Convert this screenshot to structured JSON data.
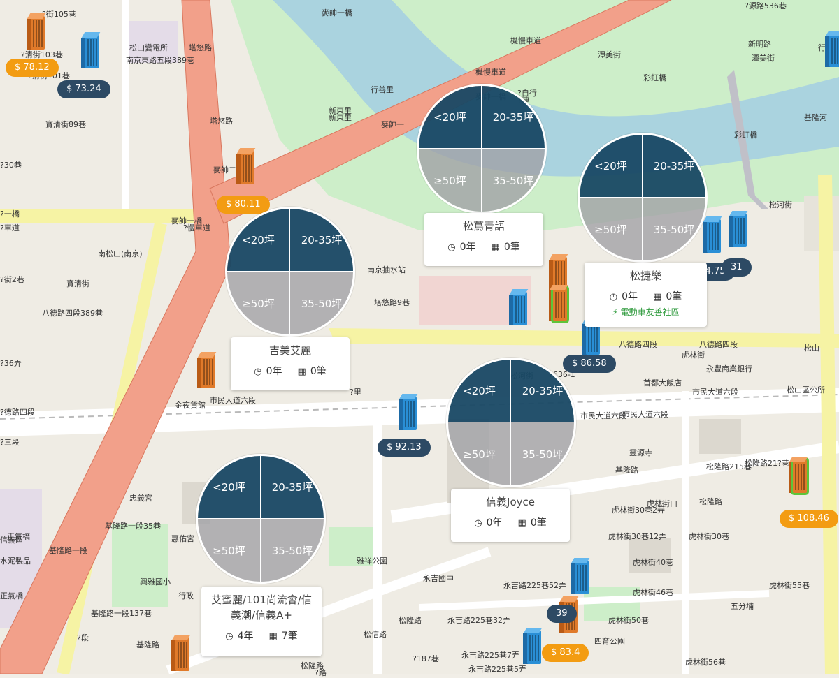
{
  "colors": {
    "river": "#aad3df",
    "park": "#c8f0c8",
    "major_road": "#f2a08a",
    "secondary_road": "#f6f3a4",
    "cluster_dark": "#184864",
    "cluster_light": "#a0a0a5",
    "price_orange": "#f39c12",
    "price_navy": "#2d4a64",
    "eco_green": "#2e9a3c"
  },
  "map_labels": [
    "?街105巷",
    "?清街103巷",
    "?清街101巷",
    "松山變電所",
    "南京東路五段389巷",
    "寶清街89巷",
    "?30巷",
    "麥帥一橋",
    "?車道",
    "?一橋",
    "?慢車道",
    "南松山(南京)",
    "寶清街",
    "?街2巷",
    "八德路四段389巷",
    "?36弄",
    "?德路四段",
    "?三段",
    "塔悠路",
    "塔悠路",
    "麥帥二橋",
    "機慢車道",
    "麥帥一橋",
    "機慢車道",
    "麥帥一橋",
    "新東里",
    "行善里",
    "新東里",
    "?自行",
    "麥帥一",
    "?源路536巷",
    "新明路",
    "潭美街",
    "彩虹橋",
    "潭美街",
    "基隆河",
    "彩虹橋",
    "行善",
    "?捷",
    "松河街",
    "南京抽水站",
    "塔悠路9巷",
    "吉美艾麗",
    "八德路四段",
    "八德路四段",
    "虎林街",
    "永豐商業銀行",
    "松山",
    "首都大飯店",
    "?636-1",
    "市民大道六段",
    "市民大道六段",
    "松山區公所",
    "金夜貨館",
    "市民大道六段",
    "?里",
    "松河街",
    "市民大道六段",
    "靈源寺",
    "基隆路",
    "松隆路215巷",
    "松隆路21?巷",
    "松隆路",
    "虎林街30巷2弄",
    "虎林街口",
    "虎林街30巷12弄",
    "虎林街30巷",
    "虎林街40巷",
    "虎林街55巷",
    "虎林街46巷",
    "五分埔",
    "虎林街50巷",
    "虎林街56巷",
    "四育公園",
    "永吉路225巷52弄",
    "永吉路225巷32弄",
    "永吉路225巷7弄",
    "永吉路225巷5弄",
    "永吉國中",
    "雅祥公園",
    "松隆路",
    "松隆路",
    "基隆路一段35巷",
    "惠佑宮",
    "忠義宮",
    "興雅國小",
    "行政",
    "基隆路",
    "基隆路一段137巷",
    "基隆路一段",
    "正氣橋",
    "正氣橋",
    "信義區",
    "水泥製品",
    "?段",
    "松信路",
    "?187巷",
    "?路"
  ],
  "buildings": [
    {
      "color": "orange",
      "highlight": false
    },
    {
      "color": "blue",
      "highlight": false
    },
    {
      "color": "orange",
      "highlight": false
    },
    {
      "color": "orange",
      "highlight": false
    },
    {
      "color": "blue",
      "highlight": false
    },
    {
      "color": "blue",
      "highlight": false
    },
    {
      "color": "orange",
      "highlight": false
    },
    {
      "color": "orange",
      "highlight": true
    },
    {
      "color": "blue",
      "highlight": false
    },
    {
      "color": "blue",
      "highlight": false
    },
    {
      "color": "blue",
      "highlight": false
    },
    {
      "color": "orange",
      "highlight": true
    },
    {
      "color": "blue",
      "highlight": false
    },
    {
      "color": "orange",
      "highlight": false
    },
    {
      "color": "blue",
      "highlight": false
    },
    {
      "color": "orange",
      "highlight": false
    },
    {
      "color": "blue",
      "highlight": false
    }
  ],
  "prices": [
    {
      "text": "$ 78.12",
      "color": "orange"
    },
    {
      "text": "$ 73.24",
      "color": "navy"
    },
    {
      "text": "$ 80.11",
      "color": "orange"
    },
    {
      "text": "$ 74.75",
      "color": "navy"
    },
    {
      "text": "31",
      "color": "navy"
    },
    {
      "text": "$ 86.58",
      "color": "navy"
    },
    {
      "text": "$ 92.13",
      "color": "navy"
    },
    {
      "text": "$ 108.46",
      "color": "orange"
    },
    {
      "text": "39",
      "color": "navy"
    },
    {
      "text": "$ 83.4",
      "color": "orange"
    }
  ],
  "cluster_quadrants": {
    "q1": "<20坪",
    "q2": "20-35坪",
    "q3": "≥50坪",
    "q4": "35-50坪"
  },
  "communities": [
    {
      "name": "松蔦青語",
      "years": "0年",
      "deals": "0筆",
      "tag": ""
    },
    {
      "name": "松捷樂",
      "years": "0年",
      "deals": "0筆",
      "tag": "電動車友善社區"
    },
    {
      "name": "吉美艾麗",
      "years": "0年",
      "deals": "0筆",
      "tag": ""
    },
    {
      "name": "信義Joyce",
      "years": "0年",
      "deals": "0筆",
      "tag": ""
    },
    {
      "name": "艾蜜麗/101尚流會/信義潮/信義A+",
      "years": "4年",
      "deals": "7筆",
      "tag": ""
    }
  ]
}
